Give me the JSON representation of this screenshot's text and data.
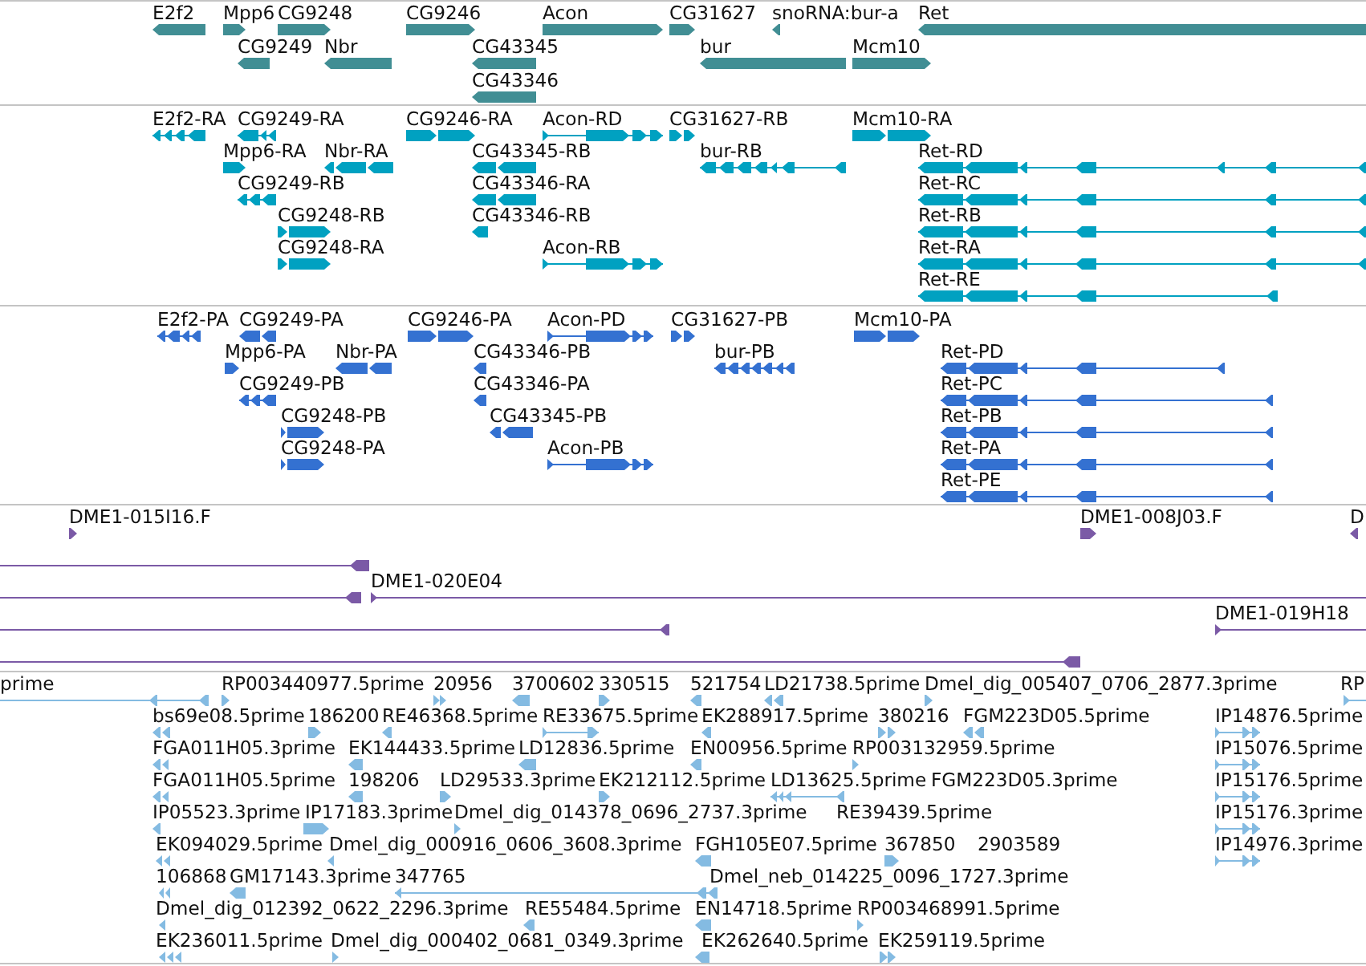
{
  "tracks": [
    {
      "color": "#418e94",
      "features": [
        {
          "label": "E2f2",
          "reverse_strand": true
        },
        {
          "label": "Mpp6",
          "reverse_strand": false
        },
        {
          "label": "CG9248",
          "reverse_strand": false
        },
        {
          "label": "CG9246",
          "reverse_strand": false
        },
        {
          "label": "Acon",
          "reverse_strand": false
        },
        {
          "label": "CG31627",
          "reverse_strand": false
        },
        {
          "label": "snoRNA:bur-a",
          "reverse_strand": true
        },
        {
          "label": "Ret",
          "reverse_strand": true
        },
        {
          "label": "CG9249",
          "reverse_strand": true
        },
        {
          "label": "Nbr",
          "reverse_strand": true
        },
        {
          "label": "CG43345",
          "reverse_strand": true
        },
        {
          "label": "bur",
          "reverse_strand": true
        },
        {
          "label": "Mcm10",
          "reverse_strand": false
        },
        {
          "label": "CG43346",
          "reverse_strand": true
        }
      ]
    },
    {
      "color": "#00a1c1",
      "features": [
        {
          "label": "E2f2-RA",
          "reverse_strand": true
        },
        {
          "label": "CG9249-RA",
          "reverse_strand": true
        },
        {
          "label": "CG9246-RA",
          "reverse_strand": false
        },
        {
          "label": "Acon-RD",
          "reverse_strand": false
        },
        {
          "label": "CG31627-RB",
          "reverse_strand": false
        },
        {
          "label": "Mcm10-RA",
          "reverse_strand": false
        },
        {
          "label": "Mpp6-RA",
          "reverse_strand": false
        },
        {
          "label": "Nbr-RA",
          "reverse_strand": true
        },
        {
          "label": "CG43345-RB",
          "reverse_strand": true
        },
        {
          "label": "bur-RB",
          "reverse_strand": true
        },
        {
          "label": "Ret-RD",
          "reverse_strand": true
        },
        {
          "label": "CG9249-RB",
          "reverse_strand": true
        },
        {
          "label": "CG43346-RA",
          "reverse_strand": true
        },
        {
          "label": "Ret-RC",
          "reverse_strand": true
        },
        {
          "label": "CG9248-RB",
          "reverse_strand": false
        },
        {
          "label": "CG43346-RB",
          "reverse_strand": true
        },
        {
          "label": "Ret-RB",
          "reverse_strand": true
        },
        {
          "label": "CG9248-RA",
          "reverse_strand": false
        },
        {
          "label": "Acon-RB",
          "reverse_strand": false
        },
        {
          "label": "Ret-RA",
          "reverse_strand": true
        },
        {
          "label": "Ret-RE",
          "reverse_strand": true
        }
      ]
    },
    {
      "color": "#3471d1",
      "features": [
        {
          "label": "E2f2-PA",
          "reverse_strand": true
        },
        {
          "label": "CG9249-PA",
          "reverse_strand": true
        },
        {
          "label": "CG9246-PA",
          "reverse_strand": false
        },
        {
          "label": "Acon-PD",
          "reverse_strand": false
        },
        {
          "label": "CG31627-PB",
          "reverse_strand": false
        },
        {
          "label": "Mcm10-PA",
          "reverse_strand": false
        },
        {
          "label": "Mpp6-PA",
          "reverse_strand": false
        },
        {
          "label": "Nbr-PA",
          "reverse_strand": true
        },
        {
          "label": "CG43346-PB",
          "reverse_strand": true
        },
        {
          "label": "bur-PB",
          "reverse_strand": true
        },
        {
          "label": "Ret-PD",
          "reverse_strand": true
        },
        {
          "label": "CG9249-PB",
          "reverse_strand": true
        },
        {
          "label": "CG43346-PA",
          "reverse_strand": true
        },
        {
          "label": "Ret-PC",
          "reverse_strand": true
        },
        {
          "label": "CG9248-PB",
          "reverse_strand": false
        },
        {
          "label": "CG43345-PB",
          "reverse_strand": true
        },
        {
          "label": "Ret-PB",
          "reverse_strand": true
        },
        {
          "label": "CG9248-PA",
          "reverse_strand": false
        },
        {
          "label": "Acon-PB",
          "reverse_strand": false
        },
        {
          "label": "Ret-PA",
          "reverse_strand": true
        },
        {
          "label": "Ret-PE",
          "reverse_strand": true
        }
      ]
    },
    {
      "color": "#7b5aa6",
      "features": [
        {
          "label": "DME1-015I16.F",
          "reverse_strand": false
        },
        {
          "label": "DME1-008J03.F",
          "reverse_strand": false
        },
        {
          "label": "D",
          "reverse_strand": true
        },
        {
          "reverse_strand": true
        },
        {
          "reverse_strand": true
        },
        {
          "label": "DME1-020E04",
          "reverse_strand": false
        },
        {
          "reverse_strand": true
        },
        {
          "label": "DME1-019H18",
          "reverse_strand": false
        },
        {
          "reverse_strand": true
        }
      ]
    },
    {
      "color": "#84bbe2",
      "features": [
        {
          "label": "prime",
          "reverse_strand": true
        },
        {
          "label": "RP003440977.5prime",
          "reverse_strand": false
        },
        {
          "label": "20956",
          "reverse_strand": false
        },
        {
          "label": "3700602",
          "reverse_strand": true
        },
        {
          "label": "330515",
          "reverse_strand": false
        },
        {
          "label": "521754",
          "reverse_strand": true
        },
        {
          "label": "LD21738.5prime",
          "reverse_strand": true
        },
        {
          "label": "Dmel_dig_005407_0706_2877.3prime",
          "reverse_strand": false
        },
        {
          "label": "RP",
          "reverse_strand": false
        },
        {
          "label": "bs69e08.5prime",
          "reverse_strand": true
        },
        {
          "label": "186200",
          "reverse_strand": false
        },
        {
          "label": "RE46368.5prime",
          "reverse_strand": true
        },
        {
          "label": "RE33675.5prime",
          "reverse_strand": false
        },
        {
          "label": "EK288917.5prime",
          "reverse_strand": true
        },
        {
          "label": "380216",
          "reverse_strand": false
        },
        {
          "label": "FGM223D05.5prime",
          "reverse_strand": true
        },
        {
          "label": "IP14876.5prime",
          "reverse_strand": false
        },
        {
          "label": "FGA011H05.3prime",
          "reverse_strand": true
        },
        {
          "label": "EK144433.5prime",
          "reverse_strand": true
        },
        {
          "label": "LD12836.5prime",
          "reverse_strand": true
        },
        {
          "label": "EN00956.5prime",
          "reverse_strand": true
        },
        {
          "label": "RP003132959.5prime",
          "reverse_strand": false
        },
        {
          "label": "IP15076.5prime",
          "reverse_strand": false
        },
        {
          "label": "FGA011H05.5prime",
          "reverse_strand": true
        },
        {
          "label": "198206",
          "reverse_strand": true
        },
        {
          "label": "LD29533.3prime",
          "reverse_strand": false
        },
        {
          "label": "EK212112.5prime",
          "reverse_strand": false
        },
        {
          "label": "LD13625.5prime",
          "reverse_strand": true
        },
        {
          "label": "FGM223D05.3prime"
        },
        {
          "label": "IP15176.5prime",
          "reverse_strand": false
        },
        {
          "label": "IP05523.3prime",
          "reverse_strand": true
        },
        {
          "label": "IP17183.3prime",
          "reverse_strand": false
        },
        {
          "label": "Dmel_dig_014378_0696_2737.3prime",
          "reverse_strand": false
        },
        {
          "label": "RE39439.5prime"
        },
        {
          "label": "IP15176.3prime",
          "reverse_strand": false
        },
        {
          "label": "EK094029.5prime",
          "reverse_strand": true
        },
        {
          "label": "Dmel_dig_000916_0606_3608.3prime",
          "reverse_strand": true
        },
        {
          "label": "FGH105E07.5prime",
          "reverse_strand": true
        },
        {
          "label": "367850",
          "reverse_strand": false
        },
        {
          "label": "2903589"
        },
        {
          "label": "IP14976.3prime",
          "reverse_strand": false
        },
        {
          "label": "106868",
          "reverse_strand": true
        },
        {
          "label": "GM17143.3prime",
          "reverse_strand": true
        },
        {
          "label": "347765",
          "reverse_strand": true
        },
        {
          "label": "Dmel_neb_014225_0096_1727.3prime"
        },
        {
          "label": "Dmel_dig_012392_0622_2296.3prime",
          "reverse_strand": true
        },
        {
          "label": "RE55484.5prime",
          "reverse_strand": true
        },
        {
          "label": "EN14718.5prime",
          "reverse_strand": true
        },
        {
          "label": "RP003468991.5prime",
          "reverse_strand": false
        },
        {
          "label": "EK236011.5prime",
          "reverse_strand": true
        },
        {
          "label": "Dmel_dig_000402_0681_0349.3prime",
          "reverse_strand": false
        },
        {
          "label": "EK262640.5prime",
          "reverse_strand": true
        },
        {
          "label": "EK259119.5prime",
          "reverse_strand": false
        }
      ]
    }
  ]
}
